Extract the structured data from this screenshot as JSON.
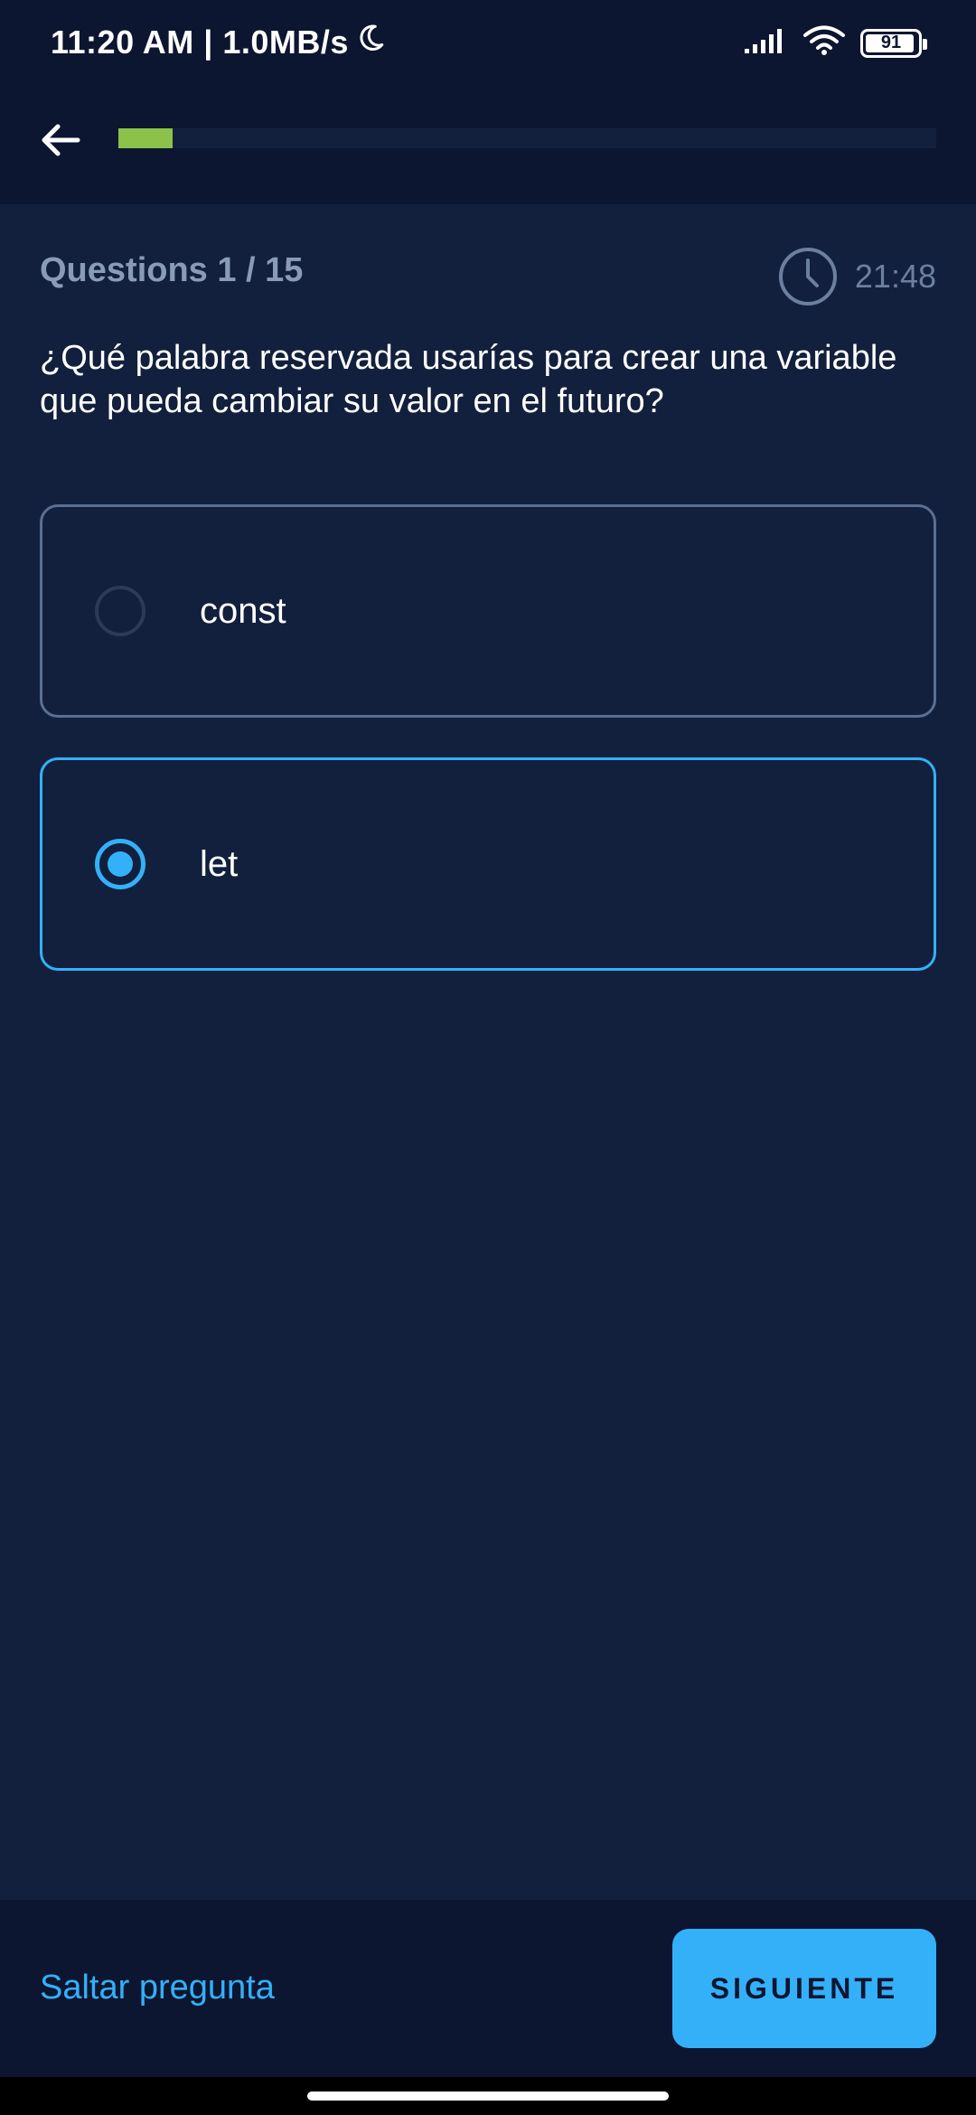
{
  "status_bar": {
    "time_speed": "11:20 AM | 1.0MB/s",
    "battery": "91"
  },
  "progress": {
    "fraction": 0.0667,
    "color": "#8bc34a"
  },
  "quiz": {
    "question_count": "Questions 1 / 15",
    "timer": "21:48",
    "question": "¿Qué palabra reservada usarías para crear una variable que pueda cambiar su valor en el futuro?",
    "options": [
      {
        "label": "const",
        "selected": false
      },
      {
        "label": "let",
        "selected": true
      }
    ]
  },
  "footer": {
    "skip_label": "Saltar pregunta",
    "next_label": "SIGUIENTE"
  },
  "colors": {
    "accent": "#34b0f8",
    "background": "#13203d",
    "bar": "#0c1631"
  }
}
